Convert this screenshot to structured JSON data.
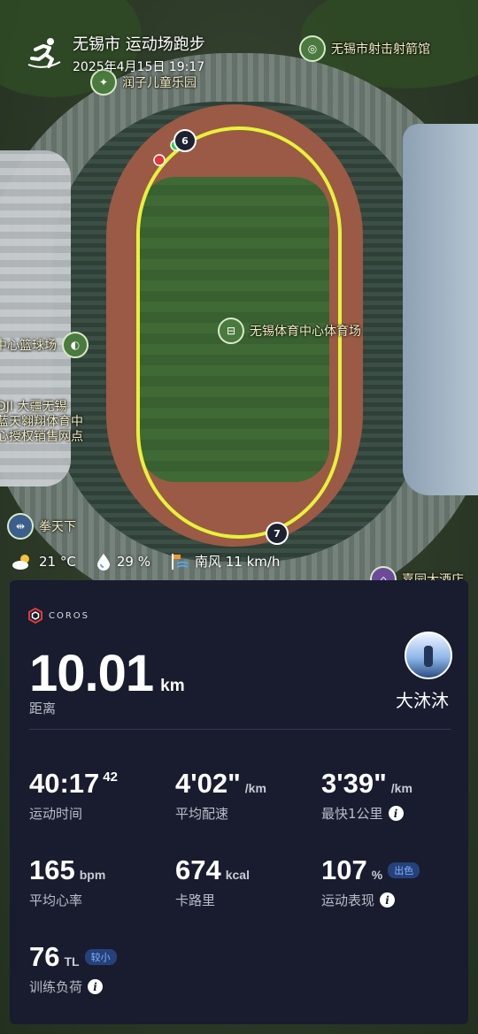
{
  "header": {
    "title": "无锡市 运动场跑步",
    "datetime": "2025年4月15日 19:17",
    "icon": "running-person-icon"
  },
  "map": {
    "pois": [
      {
        "label": "润子儿童乐园",
        "icon": "playground-icon"
      },
      {
        "label": "无锡市射击射箭馆",
        "icon": "target-icon"
      },
      {
        "label": "无锡体育中心体育场",
        "icon": "stadium-icon"
      },
      {
        "label": "中心篮球场",
        "icon": "basketball-icon"
      },
      {
        "label_lines": [
          "DJI 大疆无锡",
          "蓝天翱翔体育中",
          "心授权销售网点"
        ]
      },
      {
        "label": "拳天下",
        "icon": "dumbbell-icon"
      },
      {
        "label": "嘉园大酒店",
        "icon": "hotel-icon"
      }
    ],
    "lap_markers": [
      "6",
      "7"
    ],
    "route_color": "#e6f23a"
  },
  "weather": {
    "temperature": "21 °C",
    "humidity": "29 %",
    "wind": "南风 11 km/h"
  },
  "card": {
    "brand": "COROS",
    "distance_value": "10.01",
    "distance_unit": "km",
    "distance_label": "距离",
    "username": "大沐沐",
    "stats": {
      "time": {
        "value": "40:17",
        "sup": "42",
        "label": "运动时间"
      },
      "avg_pace": {
        "value": "4'02\"",
        "unit": "/km",
        "label": "平均配速"
      },
      "best_km": {
        "value": "3'39\"",
        "unit": "/km",
        "label": "最快1公里"
      },
      "heart_rate": {
        "value": "165",
        "unit": "bpm",
        "label": "平均心率"
      },
      "calories": {
        "value": "674",
        "unit": "kcal",
        "label": "卡路里"
      },
      "performance": {
        "value": "107",
        "unit": "%",
        "badge": "出色",
        "label": "运动表现"
      },
      "training_load": {
        "value": "76",
        "unit": "TL",
        "badge": "较小",
        "label": "训练负荷"
      }
    }
  },
  "colors": {
    "card_bg": "#181c2e",
    "route": "#e6f23a",
    "badge_bg": "#26417a",
    "badge_text": "#7fb0ff"
  }
}
